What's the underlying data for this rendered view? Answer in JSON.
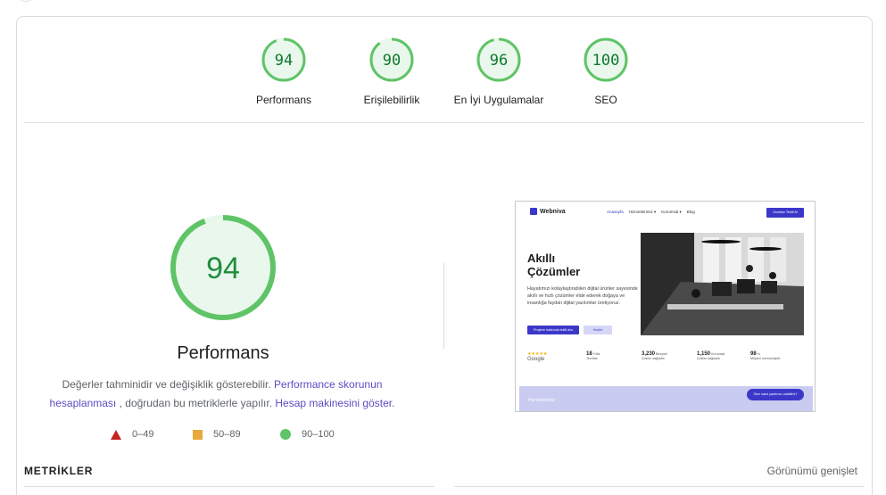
{
  "categories": [
    {
      "score": "94",
      "label": "Performans",
      "fraction": 0.94
    },
    {
      "score": "90",
      "label": "Erişilebilirlik",
      "fraction": 0.9
    },
    {
      "score": "96",
      "label": "En İyi Uygulamalar",
      "fraction": 0.96
    },
    {
      "score": "100",
      "label": "SEO",
      "fraction": 1.0
    }
  ],
  "main": {
    "score": "94",
    "score_fraction": 0.94,
    "title": "Performans",
    "desc_part1": "Değerler tahminidir ve değişiklik gösterebilir.",
    "desc_link1": "Performance skorunun hesaplanması",
    "desc_part2": ", doğrudan bu metriklerle yapılır.",
    "desc_link2": "Hesap makinesini göster",
    "desc_end": "."
  },
  "legend": [
    {
      "range": "0–49",
      "shape": "triangle",
      "color": "#c5221f"
    },
    {
      "range": "50–89",
      "shape": "square",
      "color": "#e8a93a"
    },
    {
      "range": "90–100",
      "shape": "circle",
      "color": "#5fc467"
    }
  ],
  "metrics": {
    "title": "METRİKLER",
    "expand_label": "Görünümü genişlet"
  },
  "thumbnail": {
    "logo": "Webniva",
    "menu": [
      "Anasayfa",
      "Hizmetlerimiz ▾",
      "Kurumsal ▾",
      "Blog"
    ],
    "cta": "Ücretsiz Teklif Al",
    "headline_line1": "Akıllı",
    "headline_line2": "Çözümler",
    "paragraph": "Hayatımızı kolaylaştırabilen dijital ürünler sayesinde akıllı ve hızlı çözümler elde ederek doğaya ve insanlığa faydalı dijital yazılımlar üretiyoruz.",
    "btn_primary": "Projeniz hakkında teklif alın",
    "btn_secondary": "Keşfet",
    "google_label": "Google",
    "stats": [
      {
        "value": "18",
        "unit": "Yıllık",
        "label": "Tecrübe"
      },
      {
        "value": "3,230",
        "unit": "Bireysel",
        "label": "Çözüm sağladık"
      },
      {
        "value": "1,150",
        "unit": "Kurumsal",
        "label": "Çözüm sağladık"
      },
      {
        "value": "98",
        "unit": "%",
        "label": "Müşteri memnuniyeti"
      }
    ],
    "footer_text": "Hizmetlerimiz",
    "footer_button": "Size nasıl yardımcı olabiliriz?"
  },
  "colors": {
    "pass_ring": "#5fc467",
    "pass_fill": "#eaf7ec",
    "pass_text": "#0c7a2c",
    "link": "#5b4dc4",
    "brand": "#3b38c9"
  }
}
